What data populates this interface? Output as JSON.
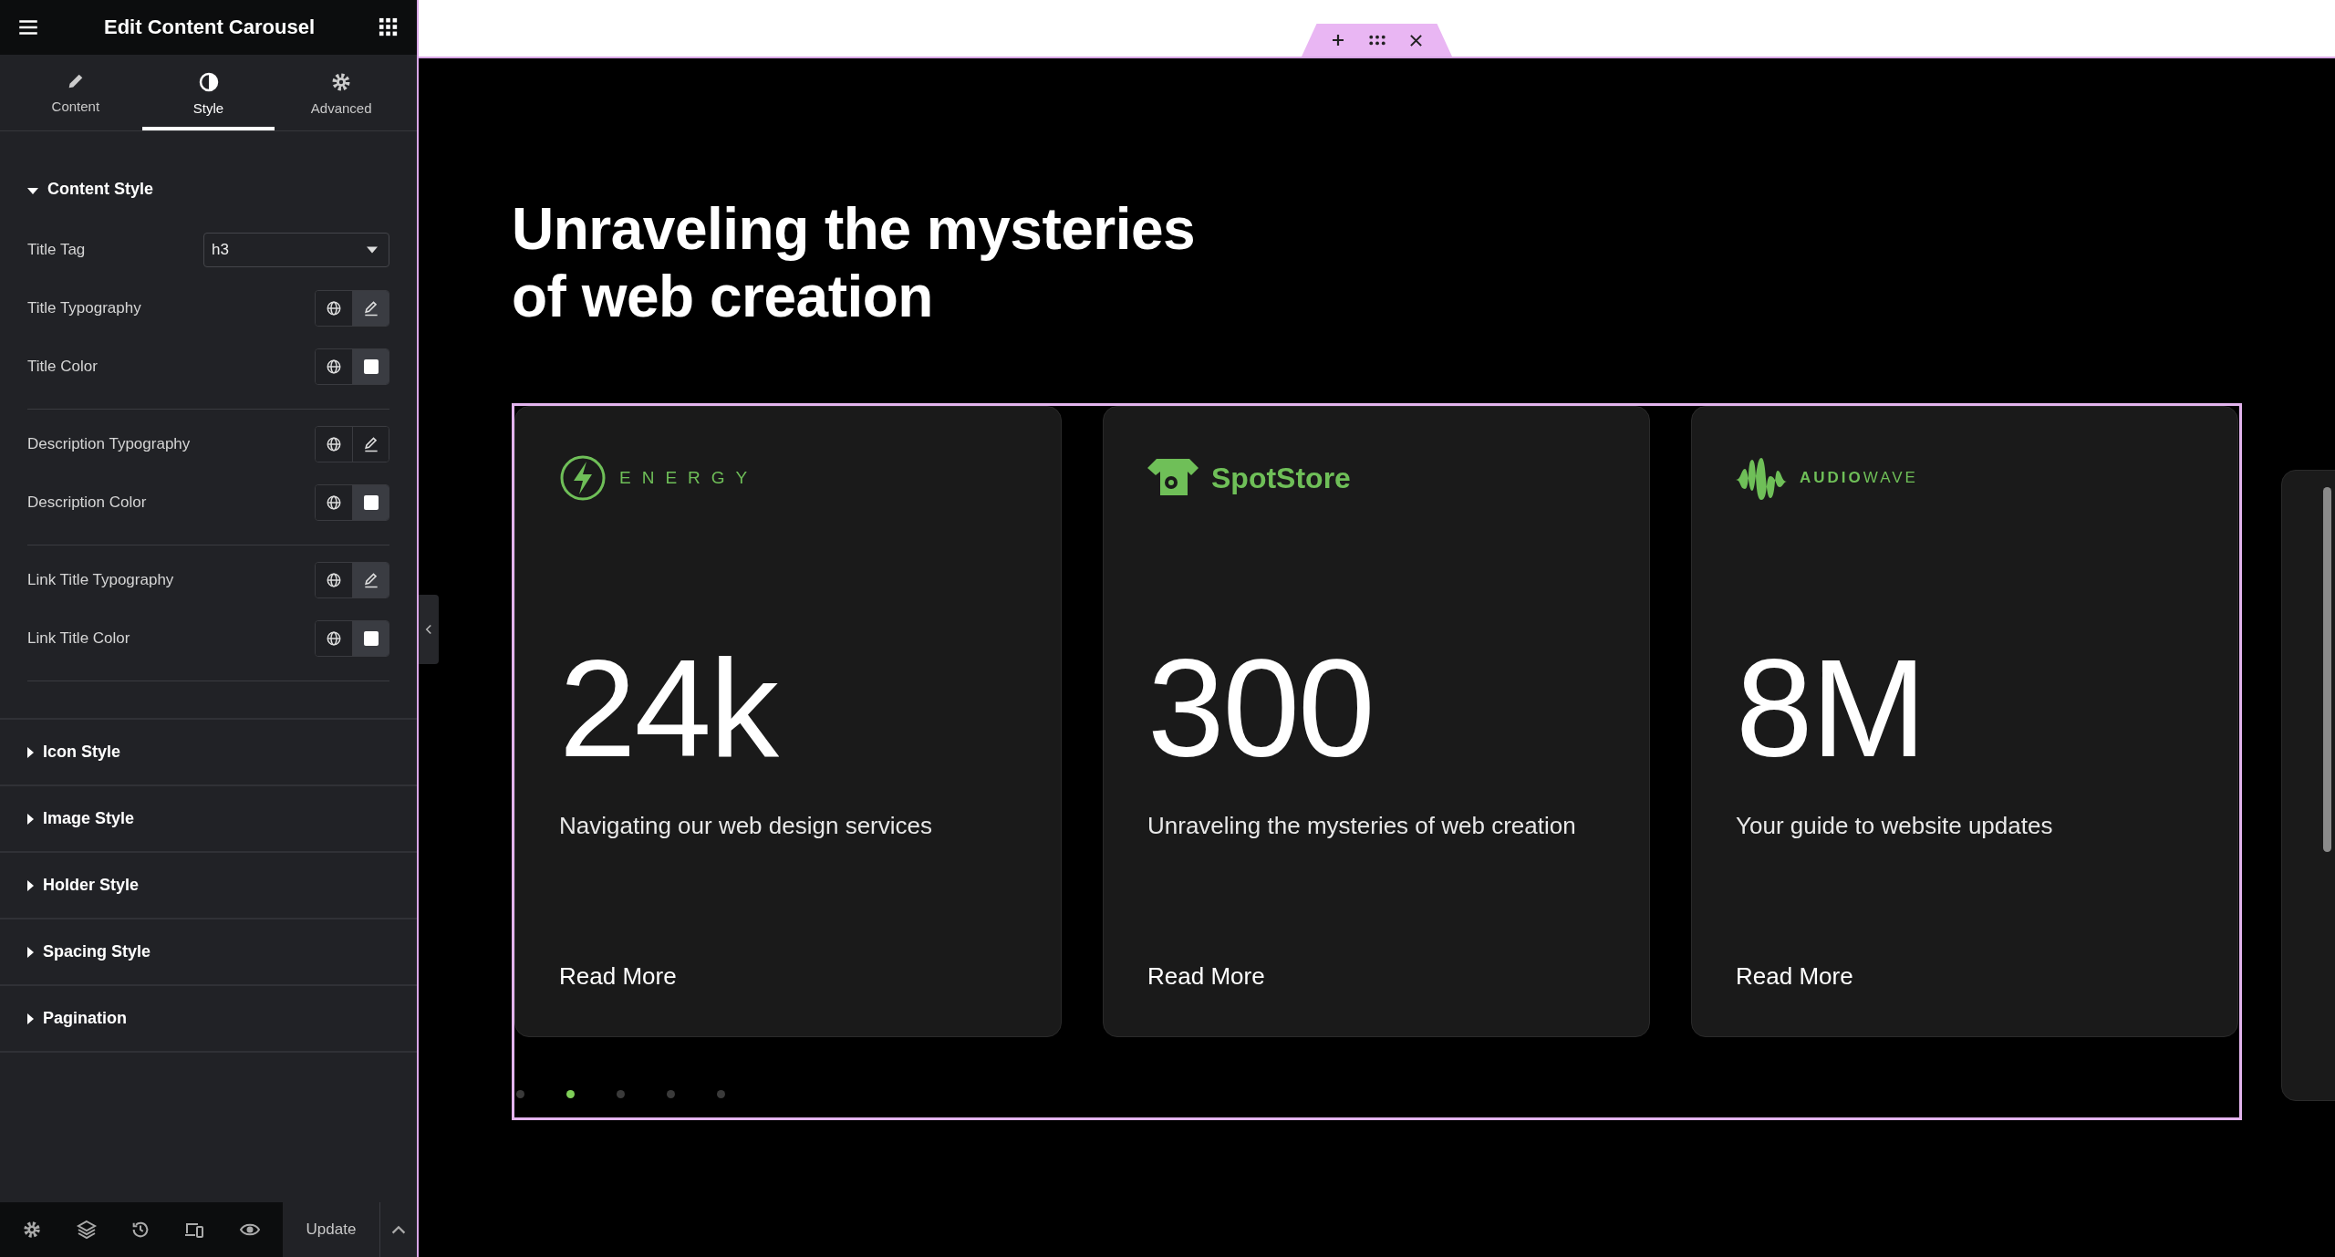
{
  "panel": {
    "title": "Edit Content Carousel",
    "tabs": [
      {
        "label": "Content",
        "selected": false
      },
      {
        "label": "Style",
        "selected": true
      },
      {
        "label": "Advanced",
        "selected": false
      }
    ],
    "sections": [
      {
        "title": "Content Style",
        "expanded": true,
        "groups": [
          [
            {
              "label": "Title Tag",
              "kind": "select",
              "value": "h3"
            },
            {
              "label": "Title Typography",
              "kind": "typography",
              "active": true
            },
            {
              "label": "Title Color",
              "kind": "color",
              "active": true
            }
          ],
          [
            {
              "label": "Description Typography",
              "kind": "typography",
              "active": false
            },
            {
              "label": "Description Color",
              "kind": "color",
              "active": true
            }
          ],
          [
            {
              "label": "Link Title Typography",
              "kind": "typography",
              "active": true
            },
            {
              "label": "Link Title Color",
              "kind": "color",
              "active": true
            }
          ]
        ]
      },
      {
        "title": "Icon Style",
        "expanded": false
      },
      {
        "title": "Image Style",
        "expanded": false
      },
      {
        "title": "Holder Style",
        "expanded": false
      },
      {
        "title": "Spacing Style",
        "expanded": false
      },
      {
        "title": "Pagination",
        "expanded": false
      }
    ],
    "footer": {
      "update": "Update"
    }
  },
  "canvas": {
    "heading": "Unraveling the mysteries of web creation",
    "cards": [
      {
        "brand": "ENERGY",
        "number": "24k",
        "description": "Navigating our web design services",
        "link": "Read More"
      },
      {
        "brand": "SpotStore",
        "number": "300",
        "description": "Unraveling the mysteries of web creation",
        "link": "Read More"
      },
      {
        "brand": "**AUDIO**WAVE",
        "number": "8M",
        "description": "Your guide to website updates",
        "link": "Read More"
      }
    ],
    "dots": [
      {
        "selected": false
      },
      {
        "selected": true
      },
      {
        "selected": false
      },
      {
        "selected": false
      },
      {
        "selected": false
      }
    ]
  }
}
